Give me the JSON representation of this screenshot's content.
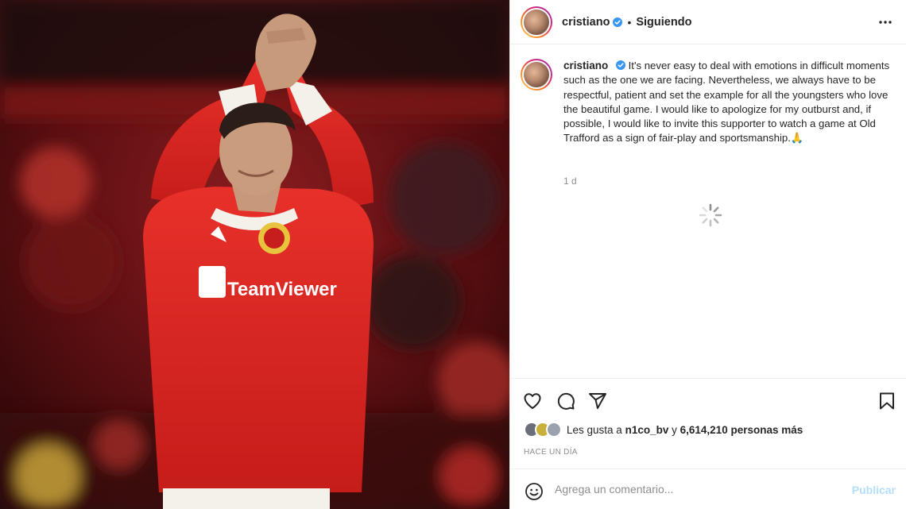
{
  "media": {
    "icon": "photo-player"
  },
  "header": {
    "username": "cristiano",
    "separator": "•",
    "following_label": "Siguiendo",
    "verified_color": "#3897f0"
  },
  "caption": {
    "username": "cristiano",
    "text": "It's never easy to deal with emotions in difficult moments such as the one we are facing. Nevertheless, we always have to be respectful, patient and set the example for all the youngsters who love the beautiful game. I would like to apologize for my outburst and, if possible, I would like to invite this supporter to watch a game at Old Trafford as a sign of fair-play and sportsmanship.🙏",
    "time": "1 d"
  },
  "likes": {
    "prefix": "Les gusta a",
    "user": "n1co_bv",
    "middle": "y",
    "count": "6,614,210 personas más"
  },
  "posted_ago": "HACE UN DÍA",
  "comment": {
    "placeholder": "Agrega un comentario...",
    "publish_label": "Publicar",
    "publish_color": "#b2dffc"
  },
  "icons": [
    "heart-icon",
    "comment-icon",
    "share-icon",
    "bookmark-icon",
    "emoji-icon",
    "more-options-icon",
    "loading-spinner-icon",
    "verified-badge-icon"
  ]
}
